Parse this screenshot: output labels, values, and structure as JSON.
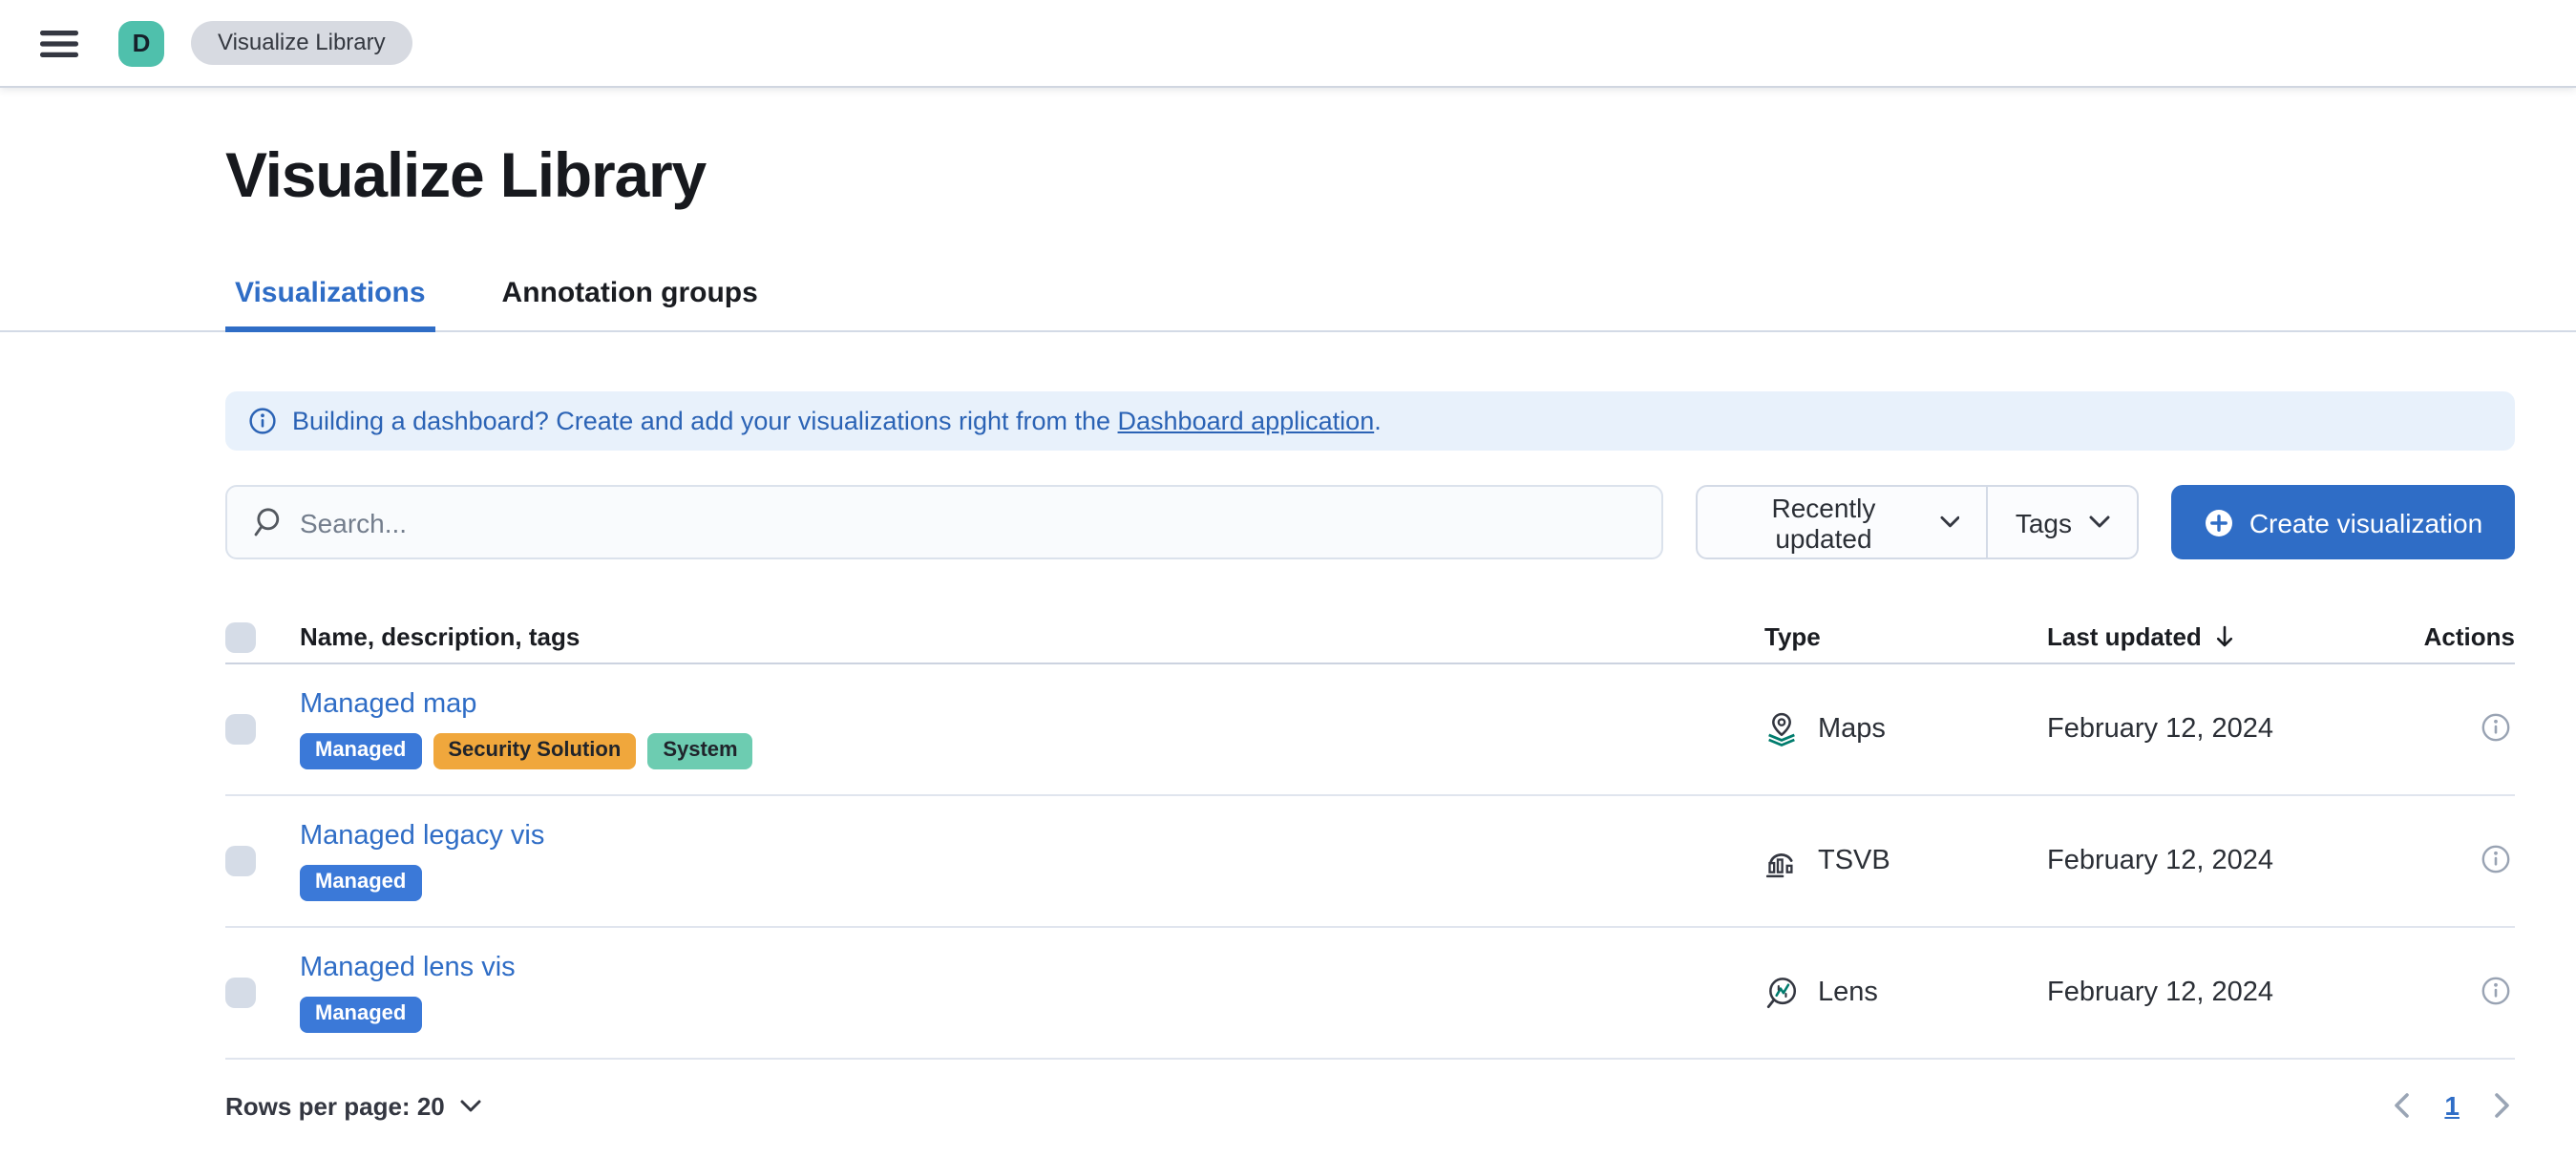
{
  "topbar": {
    "avatar_initial": "D",
    "breadcrumb": "Visualize Library"
  },
  "page": {
    "title": "Visualize Library"
  },
  "tabs": [
    {
      "label": "Visualizations",
      "active": true
    },
    {
      "label": "Annotation groups",
      "active": false
    }
  ],
  "banner": {
    "text_before_link": "Building a dashboard? Create and add your visualizations right from the ",
    "link_text": "Dashboard application",
    "text_after_link": "."
  },
  "controls": {
    "search_placeholder": "Search...",
    "search_value": "",
    "sort_selected": "Recently updated",
    "tags_label": "Tags",
    "create_label": "Create visualization"
  },
  "table": {
    "headers": {
      "name": "Name, description, tags",
      "type": "Type",
      "updated": "Last updated",
      "actions": "Actions"
    },
    "rows": [
      {
        "name": "Managed map",
        "tags": [
          {
            "label": "Managed",
            "bg": "#3b79d8",
            "fg": "#ffffff"
          },
          {
            "label": "Security Solution",
            "bg": "#f0a73c",
            "fg": "#20242b"
          },
          {
            "label": "System",
            "bg": "#6dccb1",
            "fg": "#20242b"
          }
        ],
        "type_icon": "maps-icon",
        "type": "Maps",
        "updated": "February 12, 2024"
      },
      {
        "name": "Managed legacy vis",
        "tags": [
          {
            "label": "Managed",
            "bg": "#3b79d8",
            "fg": "#ffffff"
          }
        ],
        "type_icon": "tsvb-icon",
        "type": "TSVB",
        "updated": "February 12, 2024"
      },
      {
        "name": "Managed lens vis",
        "tags": [
          {
            "label": "Managed",
            "bg": "#3b79d8",
            "fg": "#ffffff"
          }
        ],
        "type_icon": "lens-icon",
        "type": "Lens",
        "updated": "February 12, 2024"
      }
    ]
  },
  "footer": {
    "rows_per_page_label": "Rows per page: 20",
    "page_number": "1"
  },
  "colors": {
    "accent_blue": "#2f6dc6",
    "banner_bg": "#e8f1fb",
    "banner_text": "#2b63b5",
    "badge_managed": "#3b79d8",
    "badge_security_solution": "#f0a73c",
    "badge_system": "#6dccb1",
    "avatar_teal": "#4fc0ac",
    "breadcrumb_bg": "#d7dae1",
    "divider": "#e0e5ee",
    "icon_gray": "#99a3b3"
  }
}
